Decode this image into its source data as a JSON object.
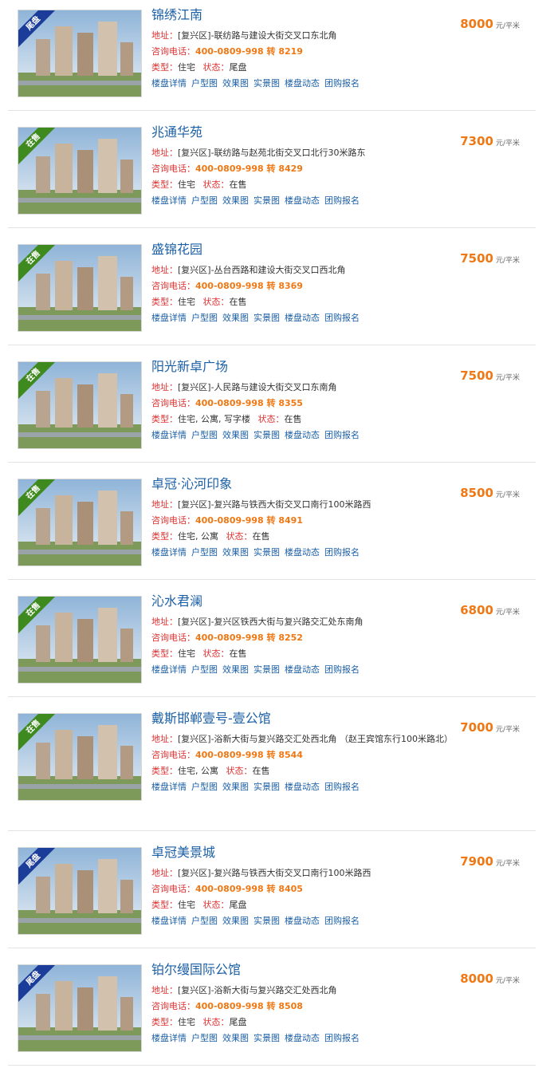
{
  "labels": {
    "address": "地址：",
    "phone": "咨询电话：",
    "type": "类型：",
    "status": "状态："
  },
  "links": [
    "楼盘详情",
    "户型图",
    "效果图",
    "实景图",
    "楼盘动态",
    "团购报名"
  ],
  "unit": "元/平米",
  "colors": {
    "link": "#1b5fa6",
    "price": "#f07814",
    "label": "#e03131",
    "onsale": "#3f8a1e",
    "tail": "#1b3d99"
  },
  "listings": [
    {
      "name": "锦绣江南",
      "badge": "尾盘",
      "badge_kind": "tail",
      "address": "[复兴区]-联纺路与建设大街交叉口东北角",
      "phone": "400-0809-998 转 8219",
      "type": "住宅",
      "status": "尾盘",
      "price": "8000"
    },
    {
      "name": "兆通华苑",
      "badge": "在售",
      "badge_kind": "onsale",
      "address": "[复兴区]-联纺路与赵苑北街交叉口北行30米路东",
      "phone": "400-0809-998 转 8429",
      "type": "住宅",
      "status": "在售",
      "price": "7300"
    },
    {
      "name": "盛锦花园",
      "badge": "在售",
      "badge_kind": "onsale",
      "address": "[复兴区]-丛台西路和建设大街交叉口西北角",
      "phone": "400-0809-998 转 8369",
      "type": "住宅",
      "status": "在售",
      "price": "7500"
    },
    {
      "name": "阳光新卓广场",
      "badge": "在售",
      "badge_kind": "onsale",
      "address": "[复兴区]-人民路与建设大街交叉口东南角",
      "phone": "400-0809-998 转 8355",
      "type": "住宅, 公寓, 写字楼",
      "status": "在售",
      "price": "7500"
    },
    {
      "name": "卓冠·沁河印象",
      "badge": "在售",
      "badge_kind": "onsale",
      "address": "[复兴区]-复兴路与铁西大街交叉口南行100米路西",
      "phone": "400-0809-998 转 8491",
      "type": "住宅, 公寓",
      "status": "在售",
      "price": "8500"
    },
    {
      "name": "沁水君澜",
      "badge": "在售",
      "badge_kind": "onsale",
      "address": "[复兴区]-复兴区铁西大街与复兴路交汇处东南角",
      "phone": "400-0809-998 转 8252",
      "type": "住宅",
      "status": "在售",
      "price": "6800"
    },
    {
      "name": "戴斯邯郸壹号-壹公馆",
      "badge": "在售",
      "badge_kind": "onsale",
      "address": "[复兴区]-浴新大街与复兴路交汇处西北角 （赵王宾馆东行100米路北）",
      "phone": "400-0809-998 转 8544",
      "type": "住宅, 公寓",
      "status": "在售",
      "price": "7000"
    },
    {
      "name": "卓冠美景城",
      "badge": "尾盘",
      "badge_kind": "tail",
      "address": "[复兴区]-复兴路与铁西大街交叉口南行100米路西",
      "phone": "400-0809-998 转 8405",
      "type": "住宅",
      "status": "尾盘",
      "price": "7900"
    },
    {
      "name": "铂尔缦国际公馆",
      "badge": "尾盘",
      "badge_kind": "tail",
      "address": "[复兴区]-浴新大街与复兴路交汇处西北角",
      "phone": "400-0809-998 转 8508",
      "type": "住宅",
      "status": "尾盘",
      "price": "8000"
    }
  ]
}
